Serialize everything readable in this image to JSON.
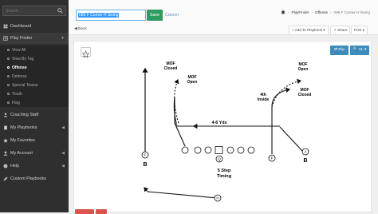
{
  "sidebar": {
    "search_placeholder": "Search...",
    "items": [
      {
        "label": "Dashboard",
        "icon": "dashboard-icon"
      },
      {
        "label": "Play Finder",
        "icon": "grid-icon"
      },
      {
        "label": "Coaching Staff",
        "icon": "staff-icon"
      },
      {
        "label": "My Playbooks",
        "icon": "book-icon"
      },
      {
        "label": "My Favorites",
        "icon": "star-icon"
      },
      {
        "label": "My Account",
        "icon": "user-icon"
      },
      {
        "label": "Help",
        "icon": "help-icon"
      },
      {
        "label": "Custom Playbooks",
        "icon": "edit-icon"
      }
    ],
    "sub_items": [
      "View All",
      "View By Tag",
      "Offense",
      "Defense",
      "Special Teams",
      "Youth",
      "Flag"
    ]
  },
  "header": {
    "play_name": "099 F Corner H Swing",
    "save_label": "Save",
    "cancel_label": "Cancel",
    "back_label": "Back",
    "breadcrumb": [
      "PlayFinder",
      "Offense",
      "099 F Corner H Swing"
    ]
  },
  "toolbar": {
    "add_label": "Add To Playbook",
    "share_label": "Share",
    "print_label": "Print",
    "flip_label": "Flip",
    "zoom_label": "XL"
  },
  "diagram": {
    "labels": {
      "mof_closed_left": [
        "MOF",
        "Closed"
      ],
      "mof_open_left": [
        "MOF",
        "Open"
      ],
      "mof_open_right": [
        "MOF",
        "Open"
      ],
      "fourth_inside": [
        "4th",
        "Inside"
      ],
      "mof_closed_right": [
        "MOF",
        "Closed"
      ],
      "yds": "4-6 Yds",
      "step": [
        "5 Step",
        "Timing"
      ],
      "b_left": "B",
      "b_right": "B"
    },
    "players": {
      "left": "F",
      "center": "Q",
      "right_f": "F",
      "right_a": "A",
      "h": "H"
    }
  }
}
